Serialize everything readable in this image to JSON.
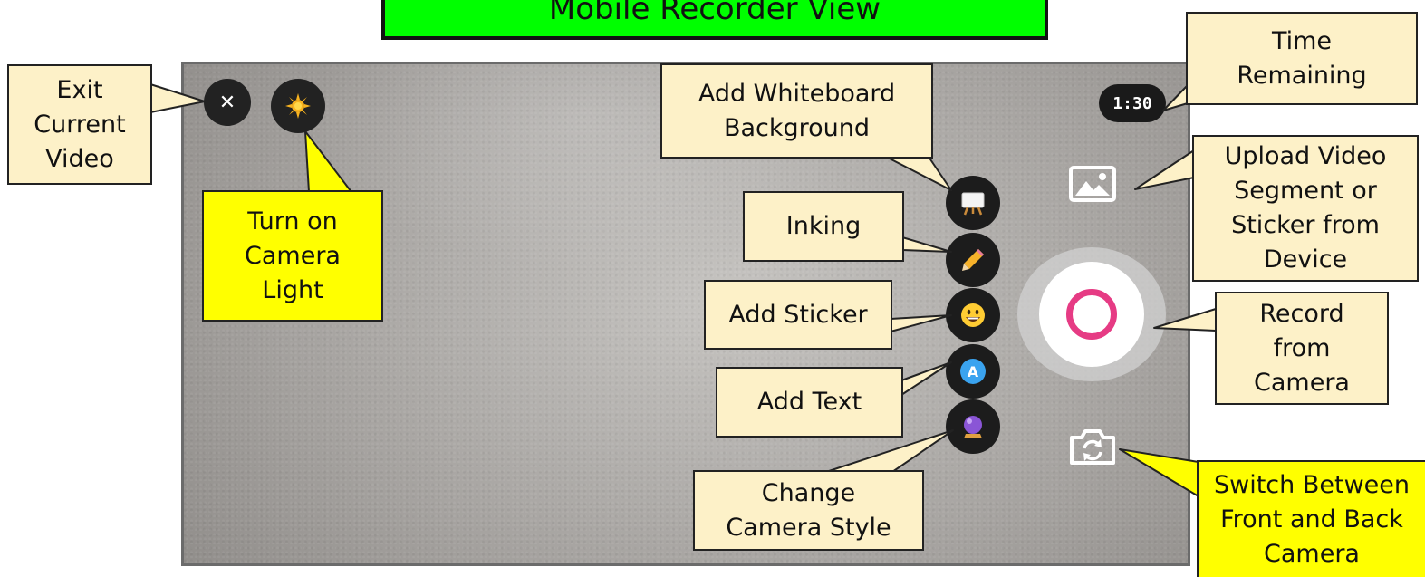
{
  "header": {
    "title": "Mobile Recorder View"
  },
  "camera_controls": {
    "timer": "1:30",
    "exit_symbol": "✕",
    "light_icon": "sun-icon",
    "tools": [
      {
        "id": "whiteboard",
        "icon": "whiteboard-icon"
      },
      {
        "id": "inking",
        "icon": "pencil-icon"
      },
      {
        "id": "sticker",
        "icon": "smiley-icon"
      },
      {
        "id": "text",
        "icon": "letter-a-icon",
        "glyph": "A"
      },
      {
        "id": "camera-style",
        "icon": "crystal-ball-icon"
      }
    ],
    "upload_icon": "image-icon",
    "record_icon": "record-icon",
    "switch_icon": "camera-switch-icon",
    "record_color": "#e63b84"
  },
  "callouts": {
    "exit": "Exit\nCurrent\nVideo",
    "light": "Turn on\nCamera\nLight",
    "whiteboard": "Add Whiteboard\nBackground",
    "inking": "Inking",
    "sticker": "Add Sticker",
    "text": "Add Text",
    "camera_style": "Change\nCamera Style",
    "time": "Time\nRemaining",
    "upload": "Upload Video\nSegment or\nSticker from\nDevice",
    "record": "Record\nfrom\nCamera",
    "switch": "Switch Between\nFront and Back\nCamera"
  },
  "colors": {
    "banner": "#00ff00",
    "callout_cream": "#fdf1c8",
    "callout_yellow": "#ffff00"
  }
}
